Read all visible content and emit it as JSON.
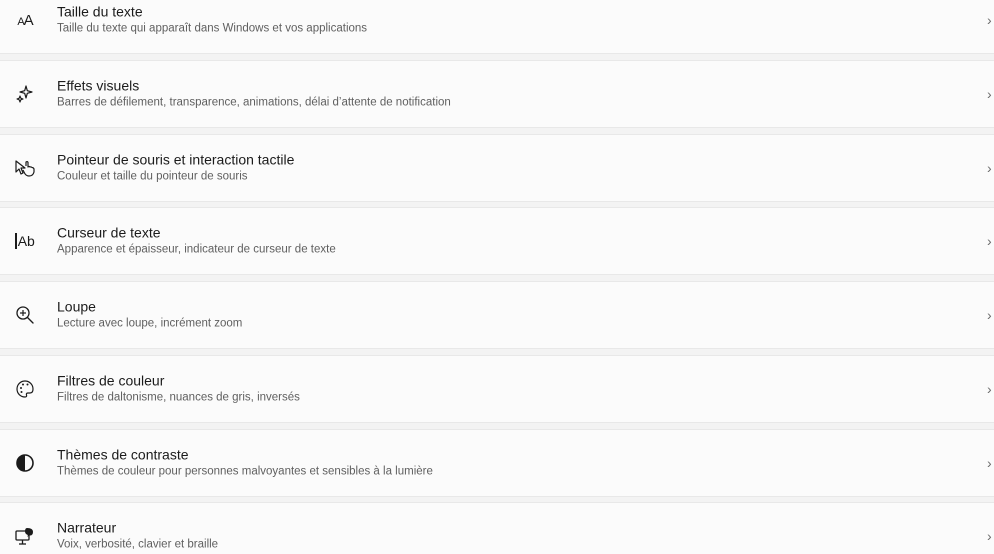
{
  "settings": {
    "items": [
      {
        "title": "Taille du texte",
        "subtitle": "Taille du texte qui apparaît dans Windows et vos applications",
        "icon": "text-size-icon"
      },
      {
        "title": "Effets visuels",
        "subtitle": "Barres de défilement, transparence, animations, délai d’attente de notification",
        "icon": "sparkle-icon"
      },
      {
        "title": "Pointeur de souris et interaction tactile",
        "subtitle": "Couleur et taille du pointeur de souris",
        "icon": "pointer-touch-icon"
      },
      {
        "title": "Curseur de texte",
        "subtitle": "Apparence et épaisseur, indicateur de curseur de texte",
        "icon": "text-cursor-icon"
      },
      {
        "title": "Loupe",
        "subtitle": "Lecture avec loupe, incrément zoom",
        "icon": "magnifier-icon"
      },
      {
        "title": "Filtres de couleur",
        "subtitle": "Filtres de daltonisme, nuances de gris, inversés",
        "icon": "palette-icon"
      },
      {
        "title": "Thèmes de contraste",
        "subtitle": "Thèmes de couleur pour personnes malvoyantes et sensibles à la lumière",
        "icon": "contrast-icon"
      },
      {
        "title": "Narrateur",
        "subtitle": "Voix, verbosité, clavier et braille",
        "icon": "narrator-icon"
      }
    ],
    "chevron": "›",
    "text_size_glyph": "AA",
    "text_cursor_glyph": "Ab"
  }
}
